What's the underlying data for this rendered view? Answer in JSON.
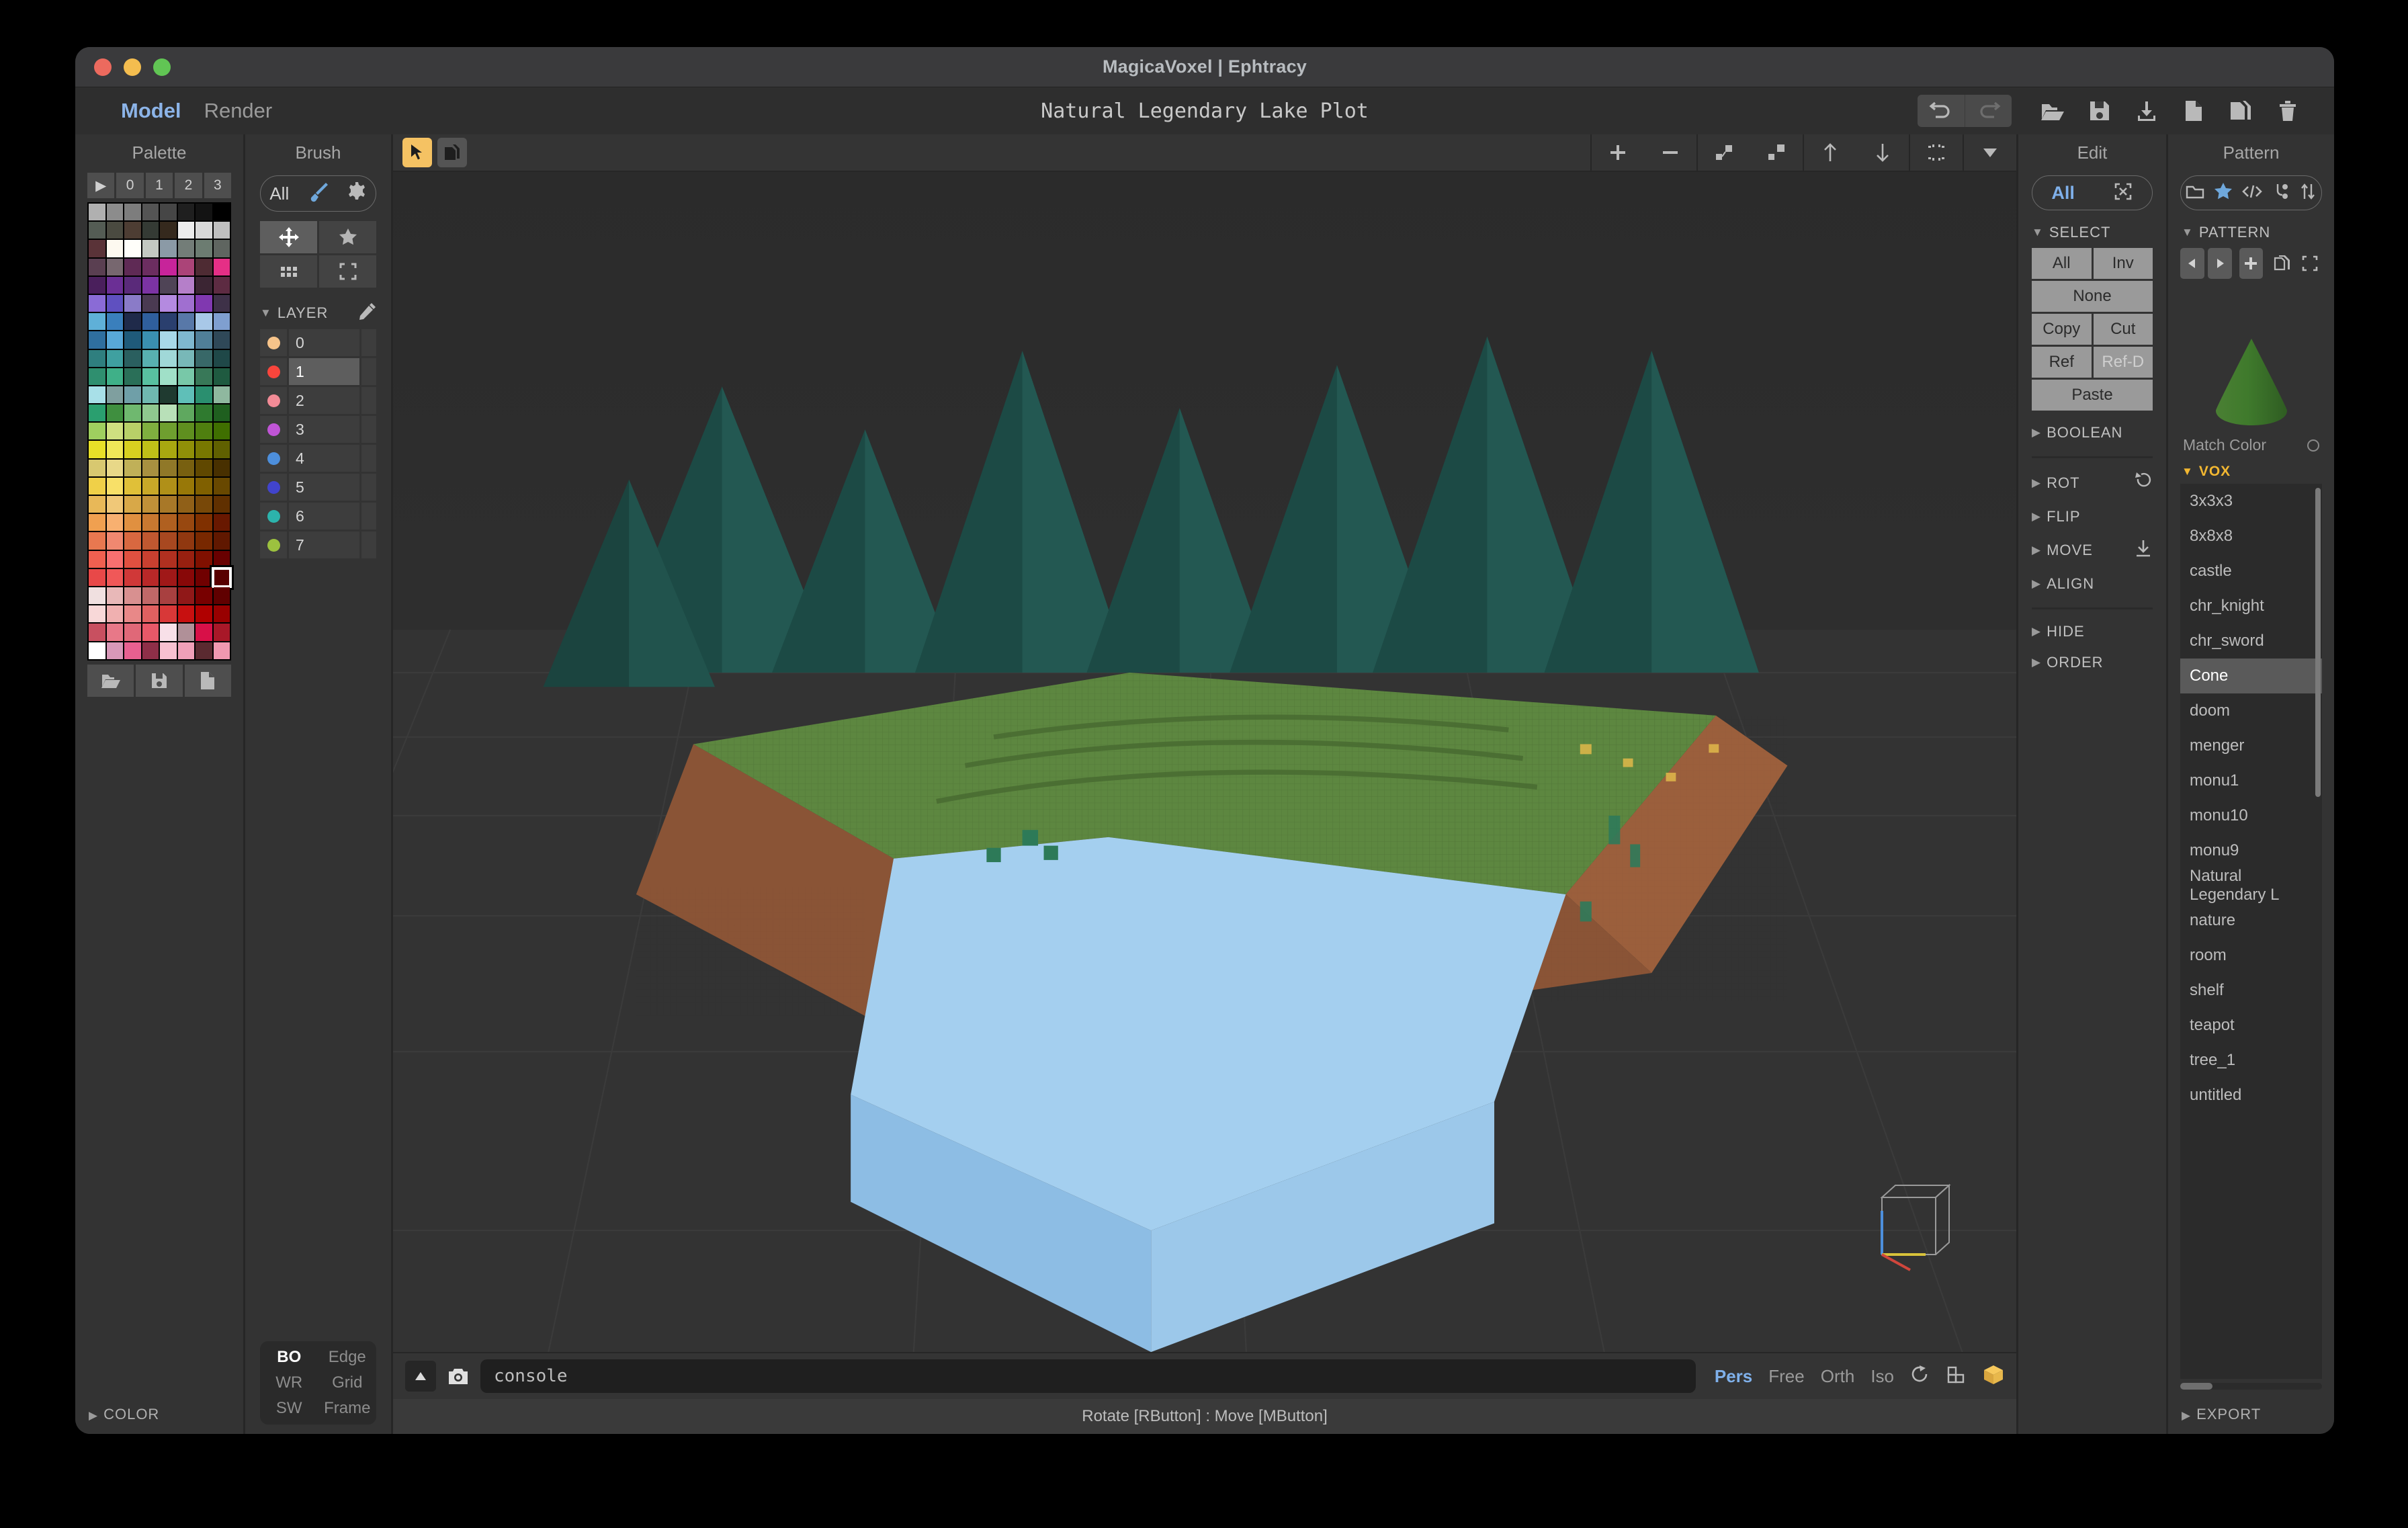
{
  "window": {
    "title": "MagicaVoxel | Ephtracy",
    "traffic": [
      "close",
      "minimize",
      "zoom"
    ]
  },
  "menu": {
    "items": [
      {
        "label": "Model",
        "active": true
      },
      {
        "label": "Render",
        "active": false
      }
    ],
    "project_title": "Natural Legendary Lake Plot",
    "toolbar_icons": [
      {
        "name": "undo-icon",
        "enabled": true
      },
      {
        "name": "redo-icon",
        "enabled": false
      },
      {
        "name": "open-folder-icon",
        "enabled": true
      },
      {
        "name": "save-icon",
        "enabled": true
      },
      {
        "name": "export-icon",
        "enabled": true
      },
      {
        "name": "new-file-icon",
        "enabled": true
      },
      {
        "name": "duplicate-icon",
        "enabled": true
      },
      {
        "name": "delete-icon",
        "enabled": true
      }
    ]
  },
  "palette": {
    "header": "Palette",
    "tabs": [
      "▶",
      "0",
      "1",
      "2",
      "3"
    ],
    "footer_icons": [
      "open-palette-icon",
      "save-palette-icon",
      "new-palette-icon"
    ],
    "color_section": "COLOR",
    "selected_index": 167,
    "colors": [
      "#b0b0b0",
      "#8c8c8c",
      "#7d7d7d",
      "#545454",
      "#464646",
      "#1f1f1f",
      "#131313",
      "#000000",
      "#545c54",
      "#4a4a40",
      "#4d3d33",
      "#343a34",
      "#35291d",
      "#ececec",
      "#d8d8d8",
      "#bfbfbf",
      "#5a3338",
      "#fdf9f0",
      "#fffefa",
      "#c3c8c2",
      "#8b9aa6",
      "#737d78",
      "#6c7c71",
      "#5f6560",
      "#5a3f51",
      "#77676f",
      "#5f2a55",
      "#6b2d60",
      "#c7249a",
      "#ab4478",
      "#4e2b33",
      "#e52f86",
      "#4a1f5c",
      "#6b2f95",
      "#5a2a7a",
      "#7b33a3",
      "#4f4456",
      "#b57fc9",
      "#3b2533",
      "#5d2b42",
      "#8a6bd6",
      "#5f50c0",
      "#8a7bc8",
      "#4a3a52",
      "#b48ae0",
      "#a06fd0",
      "#8038b0",
      "#3e3148",
      "#5fb0d8",
      "#3a7fbc",
      "#1f2a4a",
      "#2f5f9c",
      "#2a3f6e",
      "#5878a8",
      "#a8c8e8",
      "#7f9fd0",
      "#2f6f9f",
      "#58a8d8",
      "#1f5a7a",
      "#3a8fb0",
      "#a8d8e8",
      "#7fb8cf",
      "#507f98",
      "#2f4858",
      "#2f7f7f",
      "#3fa0a0",
      "#2a5f5f",
      "#58b0b0",
      "#a0d8d8",
      "#78b8b8",
      "#386868",
      "#1f4848",
      "#2f8f6f",
      "#3fb088",
      "#2a6f58",
      "#58c0a0",
      "#a0e0c8",
      "#78c8a8",
      "#387858",
      "#1f5a40",
      "#a8e0e8",
      "#7f9f9f",
      "#6f9fa8",
      "#6fb8b0",
      "#1f3a30",
      "#5fbfb8",
      "#2a8f6f",
      "#8fb89f",
      "#2a9f6f",
      "#3f8f3f",
      "#6fb86f",
      "#8fc88f",
      "#b8e0b8",
      "#5fa85f",
      "#2f7a2f",
      "#1f5f1f",
      "#9fcf5f",
      "#cfe080",
      "#b8d068",
      "#7faf3f",
      "#6f9f2f",
      "#5f8f1f",
      "#4f7f0f",
      "#3f6f00",
      "#e8e028",
      "#f0e858",
      "#d8d020",
      "#c0c018",
      "#a8a810",
      "#909008",
      "#787800",
      "#606000",
      "#d8c870",
      "#e8d888",
      "#c0b058",
      "#a89040",
      "#907828",
      "#786010",
      "#604800",
      "#483000",
      "#f0d048",
      "#f8e068",
      "#e0c038",
      "#c8a828",
      "#b09018",
      "#987808",
      "#806000",
      "#684800",
      "#e8b858",
      "#f0c878",
      "#d8a848",
      "#c09038",
      "#a87828",
      "#906018",
      "#784808",
      "#603000",
      "#f0a050",
      "#f8b070",
      "#e09040",
      "#c87830",
      "#b06020",
      "#984810",
      "#803000",
      "#681800",
      "#e87850",
      "#f08870",
      "#d86840",
      "#c05830",
      "#a84820",
      "#903810",
      "#782800",
      "#601800",
      "#f06050",
      "#f87070",
      "#e05040",
      "#c84030",
      "#b03020",
      "#982010",
      "#801000",
      "#680000",
      "#e84848",
      "#f05858",
      "#d03838",
      "#b82828",
      "#a01818",
      "#880808",
      "#700000",
      "#580000",
      "#f0e0e0",
      "#e8b8b8",
      "#d89090",
      "#c06868",
      "#a84040",
      "#901818",
      "#780000",
      "#600000",
      "#f8d8d8",
      "#f0b0b0",
      "#e88888",
      "#e06060",
      "#d83838",
      "#c81010",
      "#b00000",
      "#980000",
      "#c85060",
      "#e87888",
      "#e06878",
      "#e85868",
      "#f8e0e8",
      "#b09098",
      "#d81048",
      "#a81828",
      "#ffffff",
      "#d898b8",
      "#e86090",
      "#8e2f48",
      "#f8c0d0",
      "#f0a0b8",
      "#5a2a30",
      "#f098b0"
    ]
  },
  "brush": {
    "header": "Brush",
    "mode_label": "All",
    "mode_icons": [
      "brush-icon",
      "gear-icon"
    ],
    "tool_grid": [
      {
        "name": "move-tool-icon",
        "active": true
      },
      {
        "name": "star-tool-icon",
        "active": false
      },
      {
        "name": "grid-tool-icon",
        "active": false
      },
      {
        "name": "frame-tool-icon",
        "active": false
      }
    ],
    "layer_section": "LAYER",
    "layers": [
      {
        "id": "0",
        "color": "#f7c48a",
        "active": false
      },
      {
        "id": "1",
        "color": "#f9453c",
        "active": true
      },
      {
        "id": "2",
        "color": "#f28b96",
        "active": false
      },
      {
        "id": "3",
        "color": "#c055d6",
        "active": false
      },
      {
        "id": "4",
        "color": "#4d8fdc",
        "active": false
      },
      {
        "id": "5",
        "color": "#4144cc",
        "active": false
      },
      {
        "id": "6",
        "color": "#2cb3ac",
        "active": false
      },
      {
        "id": "7",
        "color": "#9cc13f",
        "active": false
      }
    ],
    "footer": [
      {
        "label": "BO",
        "active": true
      },
      {
        "label": "Edge",
        "active": false
      },
      {
        "label": "WR",
        "active": false
      },
      {
        "label": "Grid",
        "active": false
      },
      {
        "label": "SW",
        "active": false
      },
      {
        "label": "Frame",
        "active": false
      }
    ]
  },
  "viewport": {
    "left_tools": [
      {
        "name": "cursor-tool-icon",
        "active": true
      },
      {
        "name": "copy-tool-icon",
        "active": false
      }
    ],
    "right_tools": [
      {
        "name": "plus-icon"
      },
      {
        "name": "minus-icon"
      },
      {
        "name": "scale-down-icon"
      },
      {
        "name": "scale-up-icon"
      },
      {
        "name": "arrow-up-icon"
      },
      {
        "name": "arrow-down-icon"
      },
      {
        "name": "fit-icon"
      },
      {
        "name": "chevron-down-icon"
      }
    ]
  },
  "console": {
    "collapse_icon": "triangle-up-icon",
    "camera_icon": "camera-icon",
    "value": "console",
    "placeholder": "console",
    "view_modes": [
      {
        "label": "Pers",
        "active": true
      },
      {
        "label": "Free",
        "active": false
      },
      {
        "label": "Orth",
        "active": false
      },
      {
        "label": "Iso",
        "active": false
      }
    ],
    "extra_icons": [
      "rotate-view-icon",
      "layout-icon",
      "box-icon"
    ]
  },
  "statusbar": {
    "hint": "Rotate [RButton] : Move [MButton]"
  },
  "edit": {
    "header": "Edit",
    "mode_label": "All",
    "mode_icon": "expand-icon",
    "sections": [
      {
        "name": "SELECT",
        "label": "SELECT",
        "open": true
      },
      {
        "name": "BOOLEAN",
        "label": "BOOLEAN",
        "open": false
      },
      {
        "name": "ROT",
        "label": "ROT",
        "open": false,
        "icon": "rotate-ccw-icon"
      },
      {
        "name": "FLIP",
        "label": "FLIP",
        "open": false
      },
      {
        "name": "MOVE",
        "label": "MOVE",
        "open": false,
        "icon": "move-down-icon"
      },
      {
        "name": "ALIGN",
        "label": "ALIGN",
        "open": false
      },
      {
        "name": "HIDE",
        "label": "HIDE",
        "open": false
      },
      {
        "name": "ORDER",
        "label": "ORDER",
        "open": false
      }
    ],
    "select_buttons": [
      [
        "All",
        "Inv"
      ],
      [
        "None"
      ],
      [
        "Copy",
        "Cut"
      ],
      [
        "Ref",
        "Ref-D"
      ],
      [
        "Paste"
      ]
    ],
    "disabled_buttons": [
      "Ref-D"
    ]
  },
  "pattern": {
    "header": "Pattern",
    "top_icons": [
      {
        "name": "folder-icon",
        "active": false
      },
      {
        "name": "star-icon",
        "active": true
      },
      {
        "name": "code-icon",
        "active": false
      },
      {
        "name": "node-icon",
        "active": false
      },
      {
        "name": "sort-icon",
        "active": false
      }
    ],
    "section": "PATTERN",
    "action_icons": [
      "prev-icon",
      "next-icon",
      "add-icon",
      "duplicate-icon",
      "frame-icon"
    ],
    "preview_name": "cone-preview",
    "preview_color": "#3e7a2e",
    "match_color_label": "Match Color",
    "match_color_on": false,
    "vox_header": "VOX",
    "vox_items": [
      {
        "label": "3x3x3",
        "selected": false
      },
      {
        "label": "8x8x8",
        "selected": false
      },
      {
        "label": "castle",
        "selected": false
      },
      {
        "label": "chr_knight",
        "selected": false
      },
      {
        "label": "chr_sword",
        "selected": false
      },
      {
        "label": "Cone",
        "selected": true
      },
      {
        "label": "doom",
        "selected": false
      },
      {
        "label": "menger",
        "selected": false
      },
      {
        "label": "monu1",
        "selected": false
      },
      {
        "label": "monu10",
        "selected": false
      },
      {
        "label": "monu9",
        "selected": false
      },
      {
        "label": "Natural Legendary L",
        "selected": false
      },
      {
        "label": "nature",
        "selected": false
      },
      {
        "label": "room",
        "selected": false
      },
      {
        "label": "shelf",
        "selected": false
      },
      {
        "label": "teapot",
        "selected": false
      },
      {
        "label": "tree_1",
        "selected": false
      },
      {
        "label": "untitled",
        "selected": false
      }
    ],
    "export_label": "EXPORT"
  },
  "scene": {
    "description": "voxel terrain with lake, forest of conifer trees, grass plateau and dirt cliff",
    "colors": {
      "background": "#2f2f2f",
      "ground_plane": "#343434",
      "water": "#a0cdf0",
      "water_side": "#8fbde4",
      "grass": "#5f8a42",
      "grass_dark": "#4b6f34",
      "dirt": "#8a5436",
      "dirt_dark": "#6f4028",
      "tree": "#1f4a46",
      "tree_light": "#2a5f59"
    }
  }
}
